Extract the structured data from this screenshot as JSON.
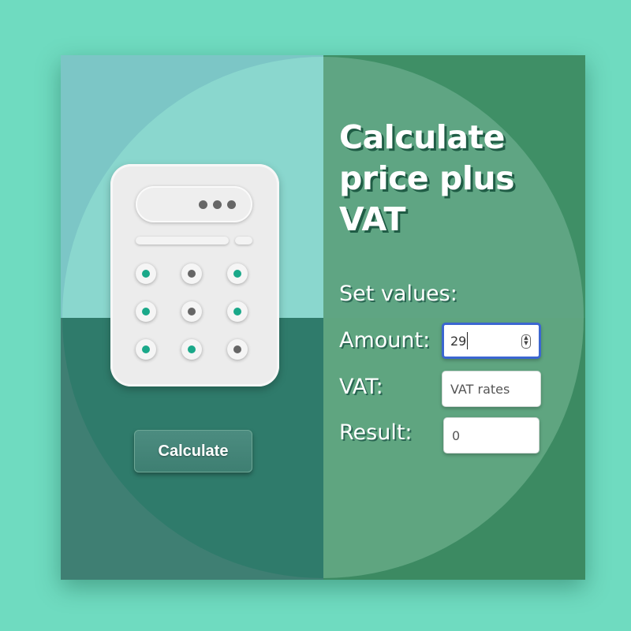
{
  "title": "Calculate price plus VAT",
  "title_lines": [
    "Calculate",
    "price plus",
    "VAT"
  ],
  "form": {
    "heading": "Set values:",
    "amount_label": "Amount:",
    "amount_value": "29",
    "vat_label": "VAT:",
    "vat_placeholder": "VAT rates",
    "result_label": "Result:",
    "result_value": "0"
  },
  "calculate_button": "Calculate",
  "colors": {
    "background": "#6fdbc0",
    "accent_key": "#1aa889",
    "gray_key": "#666666",
    "focus_border": "#3b66d1"
  },
  "illustration": {
    "name": "calculator-icon",
    "key_colors": [
      "accent",
      "gray",
      "accent",
      "accent",
      "gray",
      "accent",
      "accent",
      "accent",
      "gray"
    ]
  }
}
